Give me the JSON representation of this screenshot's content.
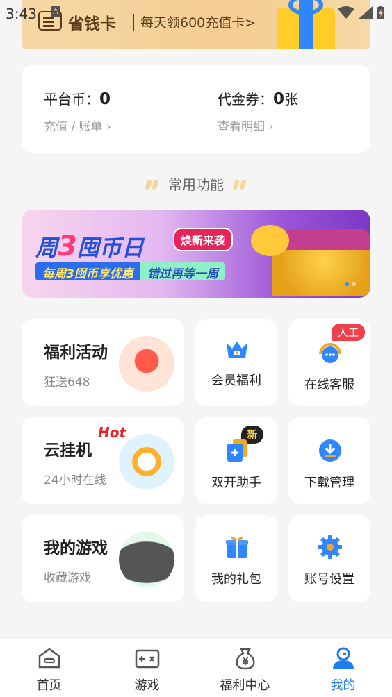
{
  "status_bar": {
    "time": "3:43",
    "indicator": "A"
  },
  "top_banner": {
    "title": "省钱卡",
    "subtitle": "每天领600充值卡>"
  },
  "balance": {
    "coins_label": "平台币：",
    "coins_value": "0",
    "coins_link": "充值 / 账单",
    "voucher_label": "代金券：",
    "voucher_value": "0",
    "voucher_unit": "张",
    "voucher_link": "查看明细"
  },
  "section": {
    "title": "常用功能"
  },
  "promo": {
    "title_pre": "周",
    "title_num": "3",
    "title_post": "囤币日",
    "tag": "焕新来袭",
    "line_a": "每周3囤币享优惠",
    "line_b": "错过再等一周"
  },
  "tiles": {
    "welfare": {
      "title": "福利活动",
      "sub": "狂送648"
    },
    "member": {
      "label": "会员福利"
    },
    "service": {
      "label": "在线客服",
      "badge": "人工"
    },
    "cloud": {
      "title": "云挂机",
      "sub": "24小时在线",
      "hot": "Hot"
    },
    "dual": {
      "label": "双开助手",
      "badge": "新"
    },
    "download": {
      "label": "下载管理"
    },
    "mygames": {
      "title": "我的游戏",
      "sub": "收藏游戏"
    },
    "gifts": {
      "label": "我的礼包"
    },
    "settings": {
      "label": "账号设置"
    }
  },
  "nav": [
    {
      "label": "首页"
    },
    {
      "label": "游戏"
    },
    {
      "label": "福利中心"
    },
    {
      "label": "我的"
    }
  ],
  "colors": {
    "accent": "#1f7cf0",
    "hot": "#ee1f1f",
    "badge": "#f0404a"
  }
}
